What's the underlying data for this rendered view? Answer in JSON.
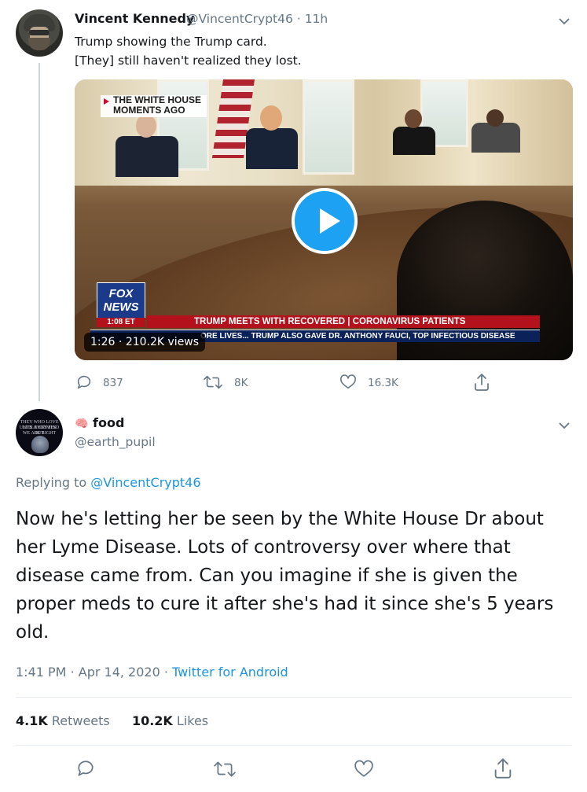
{
  "parent_tweet": {
    "author_name": "Vincent Kennedy",
    "author_handle": "@VincentCrypt46",
    "time": "11h",
    "text_line1": "Trump showing the Trump card.",
    "text_line2": "[They] still haven't realized they lost.",
    "video": {
      "overlay_white_house": "THE WHITE HOUSE",
      "overlay_moments_ago": "MOMENTS AGO",
      "fox_logo_line1": "FOX",
      "fox_logo_line2": "NEWS",
      "fox_time": "1:08 ET",
      "lower_third_1": "TRUMP MEETS WITH RECOVERED | CORONAVIRUS PATIENTS",
      "lower_third_2": "ORE LIVES...   TRUMP ALSO GAVE DR. ANTHONY FAUCI, TOP INFECTIOUS DISEASE",
      "duration": "1:26",
      "views": "210.2K views"
    },
    "actions": {
      "replies": "837",
      "retweets": "8K",
      "likes": "16.3K"
    }
  },
  "reply_tweet": {
    "author_name": "food",
    "author_emoji": "🧠",
    "author_handle": "@earth_pupil",
    "avatar_text": [
      "THEY WHO LOVE LIES & CRIMES",
      "UNTIL THEY FIND OUT",
      "WE ARE RIGHT"
    ],
    "replying_to_label": "Replying to",
    "replying_to_handle": "@VincentCrypt46",
    "body": "Now he's letting her be seen by the White House Dr about her Lyme Disease. Lots of controversy over where that disease came from. Can you imagine if she is given the proper meds to cure it after she's had it since she's 5 years old.",
    "time": "1:41 PM",
    "date": "Apr 14, 2020",
    "source": "Twitter for Android",
    "retweets_count": "4.1K",
    "retweets_label": "Retweets",
    "likes_count": "10.2K",
    "likes_label": "Likes"
  },
  "icons": [
    "chevron-down-icon",
    "play-icon",
    "reply-icon",
    "retweet-icon",
    "like-icon",
    "share-icon",
    "brain-icon"
  ],
  "colors": {
    "link": "#1b95e0",
    "muted": "#657786",
    "play_button": "#1da1f2",
    "divider": "#e6ecf0"
  }
}
